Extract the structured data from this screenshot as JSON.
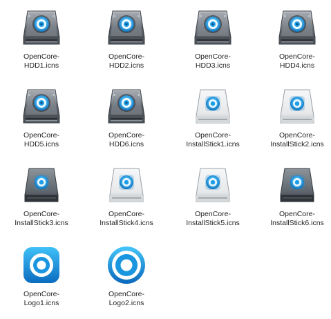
{
  "files": [
    {
      "line1": "OpenCore-",
      "line2": "HDD1.icns",
      "icon": "hdd-disk-icon",
      "kind": "hdd"
    },
    {
      "line1": "OpenCore-",
      "line2": "HDD2.icns",
      "icon": "hdd-disk-icon",
      "kind": "hdd"
    },
    {
      "line1": "OpenCore-",
      "line2": "HDD3.icns",
      "icon": "hdd-disk-icon",
      "kind": "hdd"
    },
    {
      "line1": "OpenCore-",
      "line2": "HDD4.icns",
      "icon": "hdd-disk-icon",
      "kind": "hdd"
    },
    {
      "line1": "OpenCore-",
      "line2": "HDD5.icns",
      "icon": "hdd-disk-icon",
      "kind": "hdd"
    },
    {
      "line1": "OpenCore-",
      "line2": "HDD6.icns",
      "icon": "hdd-disk-icon",
      "kind": "hdd"
    },
    {
      "line1": "OpenCore-",
      "line2": "InstallStick1.icns",
      "icon": "install-stick-white-icon",
      "kind": "stick-white"
    },
    {
      "line1": "OpenCore-",
      "line2": "InstallStick2.icns",
      "icon": "install-stick-white-icon",
      "kind": "stick-white"
    },
    {
      "line1": "OpenCore-",
      "line2": "InstallStick3.icns",
      "icon": "install-stick-gray-icon",
      "kind": "stick-gray"
    },
    {
      "line1": "OpenCore-",
      "line2": "InstallStick4.icns",
      "icon": "install-stick-white-icon",
      "kind": "stick-white"
    },
    {
      "line1": "OpenCore-",
      "line2": "InstallStick5.icns",
      "icon": "install-stick-white-icon",
      "kind": "stick-white"
    },
    {
      "line1": "OpenCore-",
      "line2": "InstallStick6.icns",
      "icon": "install-stick-gray-icon",
      "kind": "stick-gray"
    },
    {
      "line1": "OpenCore-",
      "line2": "Logo1.icns",
      "icon": "logo-square-icon",
      "kind": "logo-square"
    },
    {
      "line1": "OpenCore-",
      "line2": "Logo2.icns",
      "icon": "logo-round-icon",
      "kind": "logo-round"
    }
  ],
  "colors": {
    "label_text": "#1f1f1f",
    "accent_blue": "#1e9ee8",
    "background": "#ffffff"
  }
}
